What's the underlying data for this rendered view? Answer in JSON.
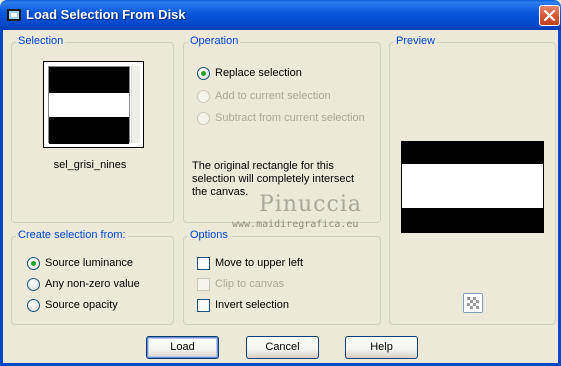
{
  "window": {
    "title": "Load Selection From Disk"
  },
  "selection": {
    "group_label": "Selection",
    "file_name": "sel_grisi_nines"
  },
  "operation": {
    "group_label": "Operation",
    "options": [
      {
        "label": "Replace selection",
        "checked": true,
        "enabled": true
      },
      {
        "label": "Add to current selection",
        "checked": false,
        "enabled": false
      },
      {
        "label": "Subtract from current selection",
        "checked": false,
        "enabled": false
      }
    ],
    "info_text": "The original rectangle for this selection will completely intersect the canvas."
  },
  "preview": {
    "group_label": "Preview"
  },
  "create_from": {
    "group_label": "Create selection from:",
    "options": [
      {
        "label": "Source luminance",
        "checked": true
      },
      {
        "label": "Any non-zero value",
        "checked": false
      },
      {
        "label": "Source opacity",
        "checked": false
      }
    ]
  },
  "options": {
    "group_label": "Options",
    "items": [
      {
        "label": "Move to upper left",
        "checked": false,
        "enabled": true
      },
      {
        "label": "Clip to canvas",
        "checked": false,
        "enabled": false
      },
      {
        "label": "Invert selection",
        "checked": false,
        "enabled": true
      }
    ]
  },
  "watermark": {
    "line1": "Pinuccia",
    "line2": "www.maidiregrafica.eu"
  },
  "buttons": {
    "load": "Load",
    "cancel": "Cancel",
    "help": "Help"
  },
  "colors": {
    "title_bar": "#0855dd",
    "group_label": "#0046d5",
    "dialog_bg": "#ece9d8",
    "close": "#d35a38"
  }
}
